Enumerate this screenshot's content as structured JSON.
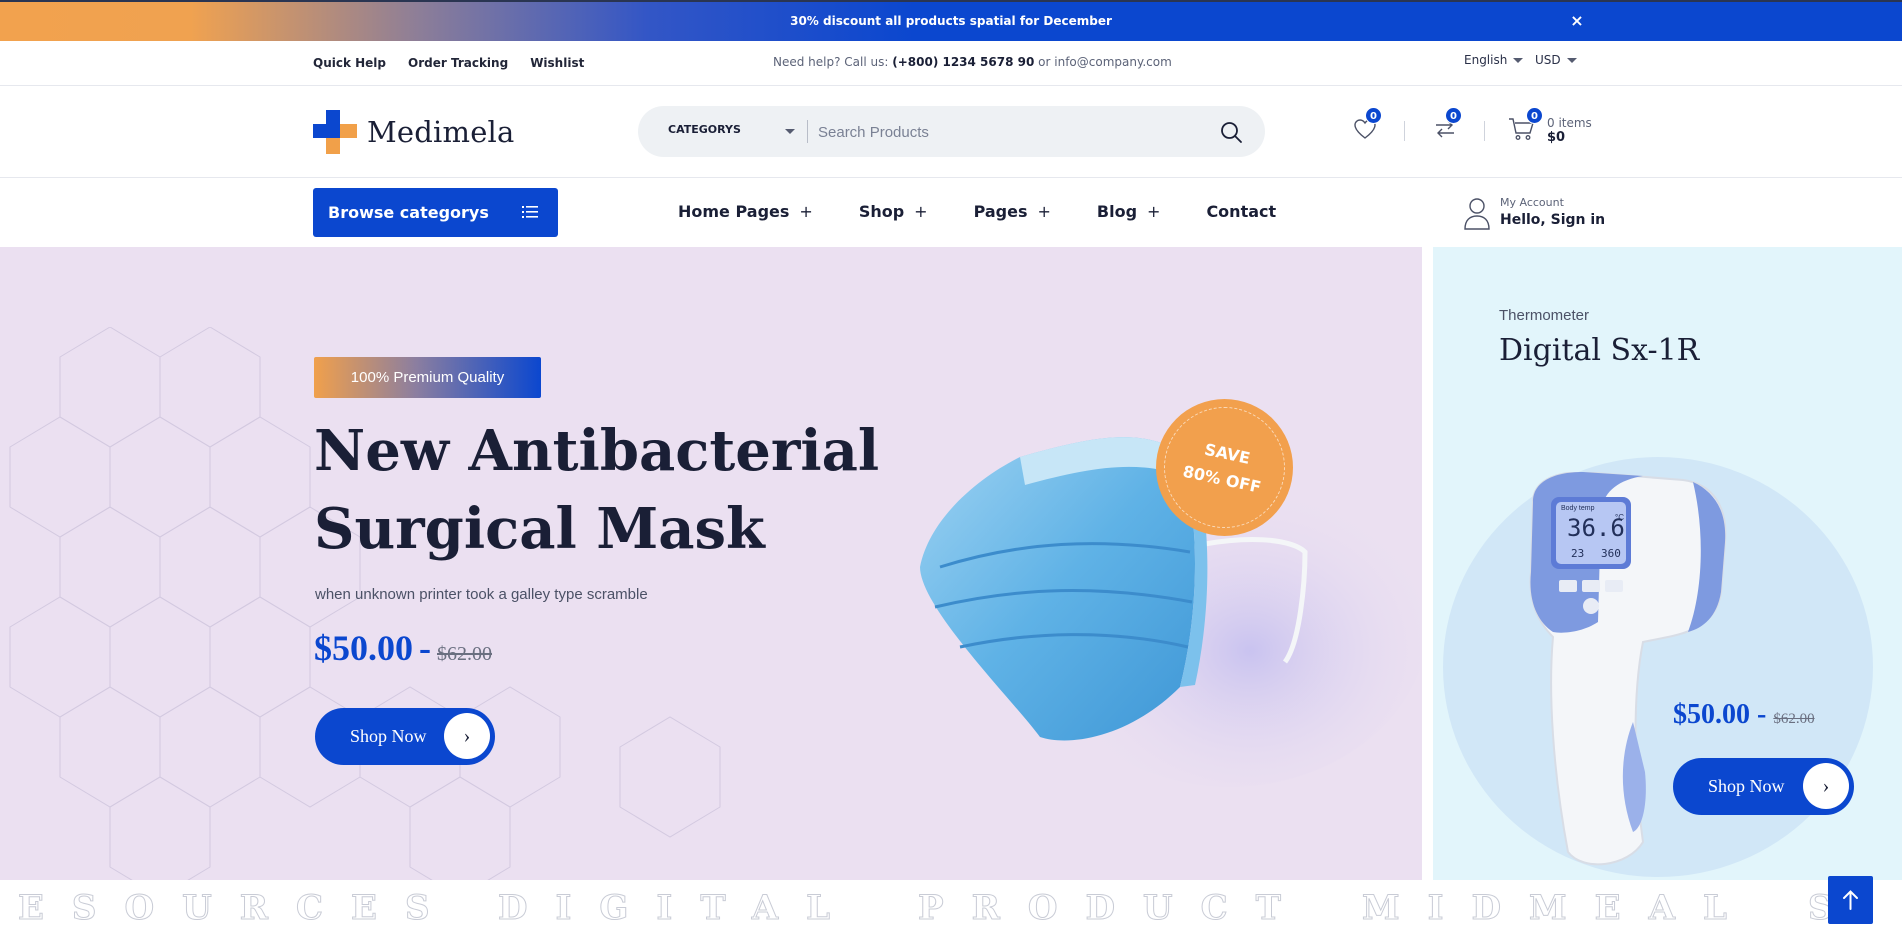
{
  "announcement": {
    "text": "30% discount all products spatial for December",
    "close_glyph": "×"
  },
  "utility": {
    "links": [
      "Quick Help",
      "Order Tracking",
      "Wishlist"
    ],
    "help_prefix": "Need help? Call us: ",
    "phone": "(+800) 1234 5678 90",
    "help_mid": " or ",
    "email": "info@company.com",
    "language": "English",
    "currency": "USD"
  },
  "header": {
    "logo_text": "Medimela",
    "search": {
      "category": "CATEGORYS",
      "placeholder": "Search Products"
    },
    "wishlist_count": "0",
    "compare_count": "0",
    "cart_count": "0",
    "cart_items": "0 items",
    "cart_total": "$0"
  },
  "nav": {
    "browse_label": "Browse categorys",
    "items": [
      {
        "label": "Home Pages",
        "expand": "+"
      },
      {
        "label": "Shop",
        "expand": "+"
      },
      {
        "label": "Pages",
        "expand": "+"
      },
      {
        "label": "Blog",
        "expand": "+"
      },
      {
        "label": "Contact",
        "expand": ""
      }
    ],
    "account_sub": "My Account",
    "account_main": "Hello, Sign in"
  },
  "hero": {
    "tag": "100% Premium Quality",
    "title_line1": "New Antibacterial",
    "title_line2": "Surgical Mask",
    "subtitle": "when unknown printer took a galley type scramble",
    "price": "$50.00",
    "price_sep": "-",
    "old_price": "$62.00",
    "button": "Shop Now",
    "badge_line1": "SAVE",
    "badge_line2": "80% OFF"
  },
  "promo": {
    "kicker": "Thermometer",
    "title": "Digital Sx-1R",
    "price": "$50.00",
    "price_sep": "-",
    "old_price": "$62.00",
    "button": "Shop Now",
    "display_temp": "36.6",
    "display_unit": "°C",
    "display_small1": "23",
    "display_small2": "360",
    "display_caption": "Body temp"
  },
  "marquee": [
    "ESOURCES",
    "DIGITAL",
    "PRODUCT",
    "MIDMEAL",
    "S"
  ],
  "colors": {
    "primary": "#0b47cf",
    "accent": "#f2a04d",
    "hero_bg": "#ebe0f1",
    "promo_bg": "#e2f5fb"
  },
  "icons": [
    "close-icon",
    "chevron-down-icon",
    "search-icon",
    "heart-icon",
    "compare-icon",
    "cart-icon",
    "list-icon",
    "user-icon",
    "arrow-right-icon",
    "arrow-up-icon"
  ]
}
